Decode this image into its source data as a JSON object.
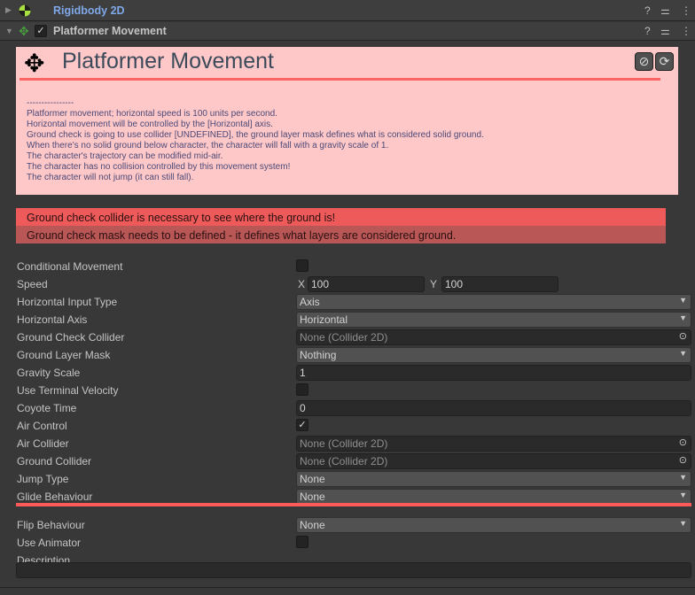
{
  "components": [
    {
      "title": "Rigidbody 2D",
      "title_color": "#7fa8e8",
      "icon": "rigidbody-icon"
    },
    {
      "title": "Platformer Movement",
      "title_color": "#c4c4c4",
      "icon": "move-icon",
      "enabled": true
    }
  ],
  "header_icons": {
    "help": "?",
    "settings": "⚌",
    "more": "⋮"
  },
  "panel": {
    "title": "Platformer Movement",
    "icon": "move-arrows-icon",
    "buttons": [
      "hide-icon",
      "refresh-icon"
    ],
    "colors": {
      "background": "#ffc8c8",
      "rule": "#ff6464"
    },
    "description": "----------------\nPlatformer movement; horizontal speed is 100 units per second.\nHorizontal movement will be controlled by the [Horizontal] axis.\nGround check is going to use collider [UNDEFINED], the ground layer mask defines what is considered solid ground.\nWhen there's no solid ground below character, the character will fall with a gravity scale of 1.\nThe character's trajectory can be modified mid-air.\nThe character has no collision controlled by this movement system!\nThe character will not jump (it can still fall)."
  },
  "errors": [
    {
      "text": "Ground check collider is necessary to see where the ground is!",
      "color": "#ee5a5a"
    },
    {
      "text": "Ground check mask needs to be defined - it defines what layers are considered ground.",
      "color": "#b95757"
    }
  ],
  "properties": [
    {
      "label": "Conditional Movement",
      "type": "checkbox",
      "checked": false
    },
    {
      "label": "Speed",
      "type": "vector2",
      "x_label": "X",
      "x": "100",
      "y_label": "Y",
      "y": "100"
    },
    {
      "label": "Horizontal Input Type",
      "type": "dropdown",
      "value": "Axis"
    },
    {
      "label": "Horizontal Axis",
      "type": "dropdown",
      "value": "Horizontal"
    },
    {
      "label": "Ground Check Collider",
      "type": "object",
      "value": "None (Collider 2D)"
    },
    {
      "label": "Ground Layer Mask",
      "type": "dropdown",
      "value": "Nothing"
    },
    {
      "label": "Gravity Scale",
      "type": "text",
      "value": "1"
    },
    {
      "label": "Use Terminal Velocity",
      "type": "checkbox",
      "checked": false
    },
    {
      "label": "Coyote Time",
      "type": "text",
      "value": "0"
    },
    {
      "label": "Air Control",
      "type": "checkbox",
      "checked": true
    },
    {
      "label": "Air Collider",
      "type": "object",
      "value": "None (Collider 2D)"
    },
    {
      "label": "Ground Collider",
      "type": "object",
      "value": "None (Collider 2D)"
    },
    {
      "label": "Jump Type",
      "type": "dropdown",
      "value": "None"
    },
    {
      "label": "Glide Behaviour",
      "type": "dropdown",
      "value": "None"
    },
    {
      "label": "Flip Behaviour",
      "type": "dropdown",
      "value": "None"
    },
    {
      "label": "Use Animator",
      "type": "checkbox",
      "checked": false
    },
    {
      "label": "Description",
      "type": "textarea",
      "value": ""
    }
  ]
}
